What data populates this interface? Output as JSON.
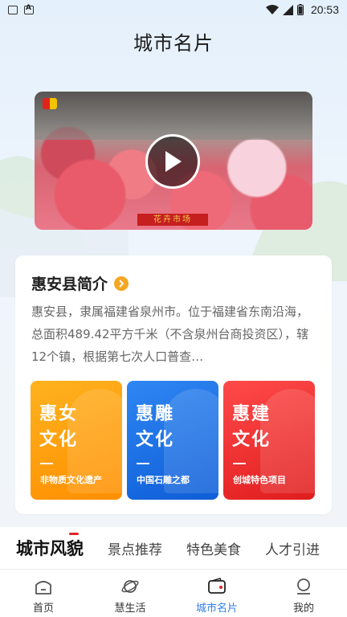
{
  "status_bar": {
    "time": "20:53"
  },
  "header": {
    "title": "城市名片"
  },
  "video": {
    "sign": "花卉市场"
  },
  "intro": {
    "title": "惠安县简介",
    "description": "惠安县，隶属福建省泉州市。位于福建省东南沿海，总面积489.42平方千米（不含泉州台商投资区），辖12个镇，根据第七次人口普查…"
  },
  "tiles": [
    {
      "title": "惠女文化",
      "subtitle": "非物质文化遗产",
      "color": "#ff9a0a"
    },
    {
      "title": "惠雕文化",
      "subtitle": "中国石雕之都",
      "color": "#1c6fe6"
    },
    {
      "title": "惠建文化",
      "subtitle": "创城特色项目",
      "color": "#f03030"
    }
  ],
  "categories": [
    {
      "label": "城市风貌"
    },
    {
      "label": "景点推荐"
    },
    {
      "label": "特色美食"
    },
    {
      "label": "人才引进"
    }
  ],
  "nav": [
    {
      "label": "首页",
      "icon": "home-icon"
    },
    {
      "label": "慧生活",
      "icon": "planet-icon"
    },
    {
      "label": "城市名片",
      "icon": "card-icon"
    },
    {
      "label": "我的",
      "icon": "user-icon"
    }
  ],
  "colors": {
    "accent": "#2f7fe8",
    "more_dot": "#f5a623",
    "tab_indicator": "#e02424"
  }
}
